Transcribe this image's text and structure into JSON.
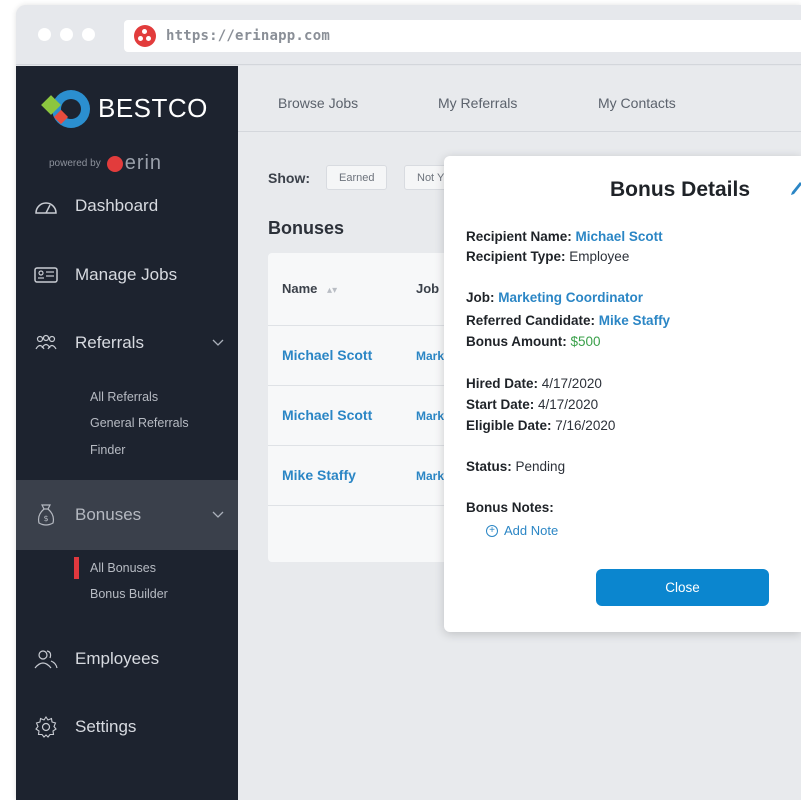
{
  "browser": {
    "url": "https://erinapp.com"
  },
  "sidebar": {
    "brand": "BESTCO",
    "powered_by": "powered by",
    "powered_word": "erin",
    "items": [
      {
        "label": "Dashboard",
        "icon": "dashboard-gauge-icon"
      },
      {
        "label": "Manage Jobs",
        "icon": "id-card-icon"
      },
      {
        "label": "Referrals",
        "icon": "people-group-icon",
        "sub": [
          "All Referrals",
          "General Referrals",
          "Finder"
        ]
      },
      {
        "label": "Bonuses",
        "icon": "money-bag-icon",
        "active": true,
        "sub": [
          "All Bonuses",
          "Bonus Builder"
        ]
      },
      {
        "label": "Employees",
        "icon": "users-icon"
      },
      {
        "label": "Settings",
        "icon": "gear-icon"
      }
    ]
  },
  "topnav": {
    "tabs": [
      "Browse Jobs",
      "My Referrals",
      "My Contacts"
    ]
  },
  "filter": {
    "label": "Show:",
    "chips": [
      "Earned",
      "Not Y"
    ]
  },
  "bonuses": {
    "title": "Bonuses",
    "columns": [
      "Name",
      "Job"
    ],
    "rows": [
      {
        "name": "Michael Scott",
        "job": "Mark"
      },
      {
        "name": "Michael Scott",
        "job": "Mark"
      },
      {
        "name": "Mike Staffy",
        "job": "Mark"
      }
    ]
  },
  "modal": {
    "title": "Bonus Details",
    "recipient_name_label": "Recipient Name:",
    "recipient_name": "Michael Scott",
    "recipient_type_label": "Recipient Type:",
    "recipient_type": "Employee",
    "job_label": "Job:",
    "job": "Marketing Coordinator",
    "candidate_label": "Referred Candidate:",
    "candidate": "Mike Staffy",
    "amount_label": "Bonus Amount:",
    "amount": "$500",
    "hired_label": "Hired Date:",
    "hired": "4/17/2020",
    "start_label": "Start Date:",
    "start": "4/17/2020",
    "eligible_label": "Eligible Date:",
    "eligible": "7/16/2020",
    "status_label": "Status:",
    "status": "Pending",
    "notes_label": "Bonus Notes:",
    "add_note": "Add Note",
    "close": "Close"
  },
  "colors": {
    "sidebar_bg": "#1d232f",
    "accent_blue": "#2b86c5",
    "button_blue": "#0b86cf",
    "money_green": "#3aa04a",
    "active_marker": "#e0383e"
  }
}
